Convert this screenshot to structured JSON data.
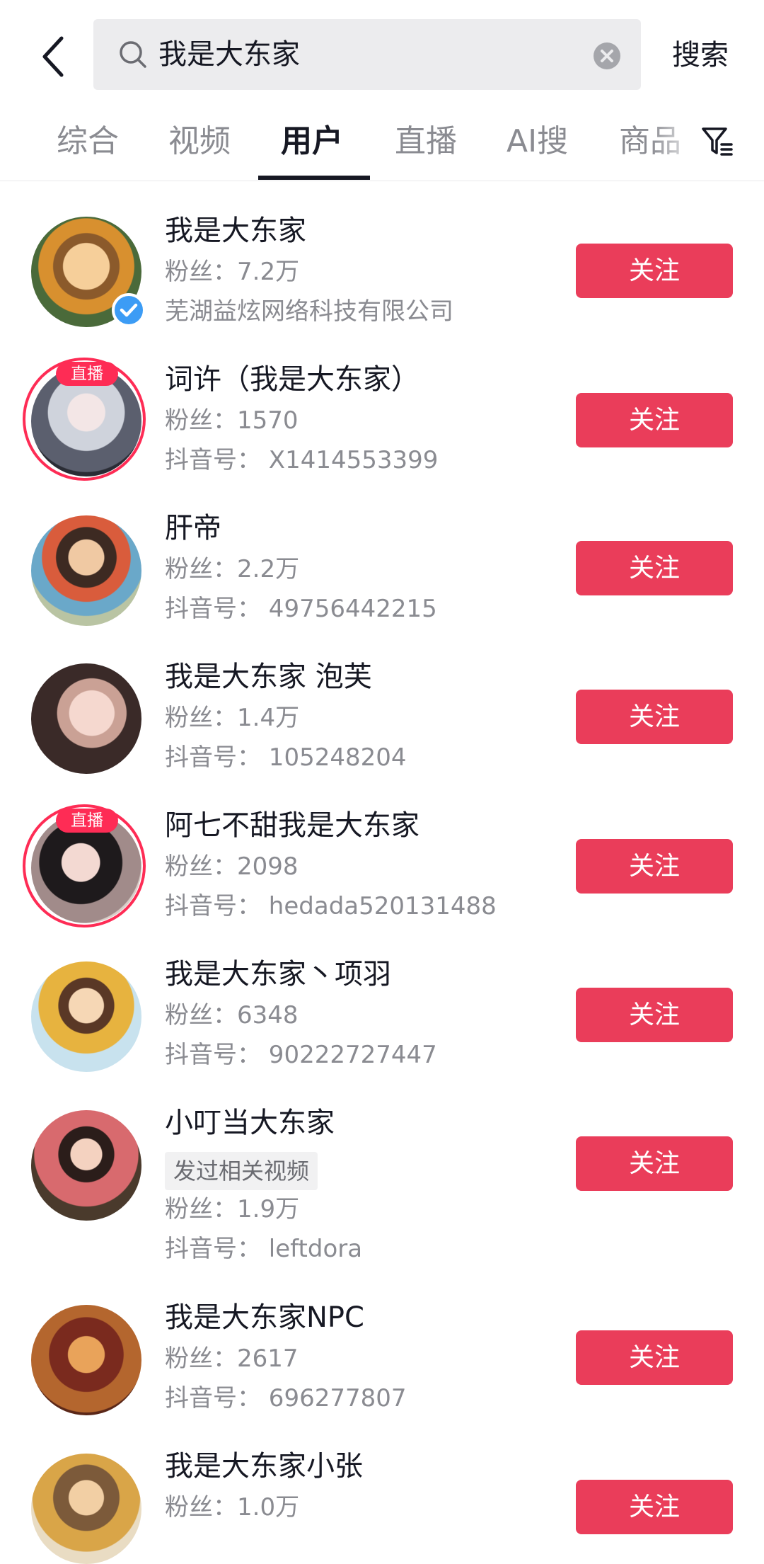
{
  "header": {
    "search_value": "我是大东家",
    "search_button": "搜索"
  },
  "tabs": [
    {
      "label": "综合"
    },
    {
      "label": "视频"
    },
    {
      "label": "用户",
      "active": true
    },
    {
      "label": "直播"
    },
    {
      "label": "AI搜"
    },
    {
      "label": "商品"
    }
  ],
  "users": [
    {
      "name": "我是大东家",
      "fans": "粉丝：7.2万",
      "detail": "芜湖益炫网络科技有限公司",
      "verified": true,
      "follow": "关注"
    },
    {
      "name": "词许（我是大东家）",
      "fans": "粉丝：1570",
      "detail": "抖音号： X1414553399",
      "live": "直播",
      "follow": "关注"
    },
    {
      "name": "肝帝",
      "fans": "粉丝：2.2万",
      "detail": "抖音号： 49756442215",
      "follow": "关注"
    },
    {
      "name": "我是大东家 泡芙",
      "fans": "粉丝：1.4万",
      "detail": "抖音号： 105248204",
      "follow": "关注"
    },
    {
      "name": "阿七不甜我是大东家",
      "fans": "粉丝：2098",
      "detail": "抖音号： hedada520131488",
      "live": "直播",
      "follow": "关注"
    },
    {
      "name": "我是大东家丶项羽",
      "fans": "粉丝：6348",
      "detail": "抖音号： 90222727447",
      "follow": "关注"
    },
    {
      "name": "小叮当大东家",
      "tag": "发过相关视频",
      "fans": "粉丝：1.9万",
      "detail": "抖音号： leftdora",
      "follow": "关注"
    },
    {
      "name": "我是大东家NPC",
      "fans": "粉丝：2617",
      "detail": "抖音号： 696277807",
      "follow": "关注"
    },
    {
      "name": "我是大东家小张",
      "fans": "粉丝：1.0万",
      "follow": "关注"
    }
  ],
  "colors": {
    "accent": "#fe2c55",
    "follow_button": "#ea3d5a",
    "verified": "#3c9cf5",
    "text_secondary": "#8a8b91"
  }
}
